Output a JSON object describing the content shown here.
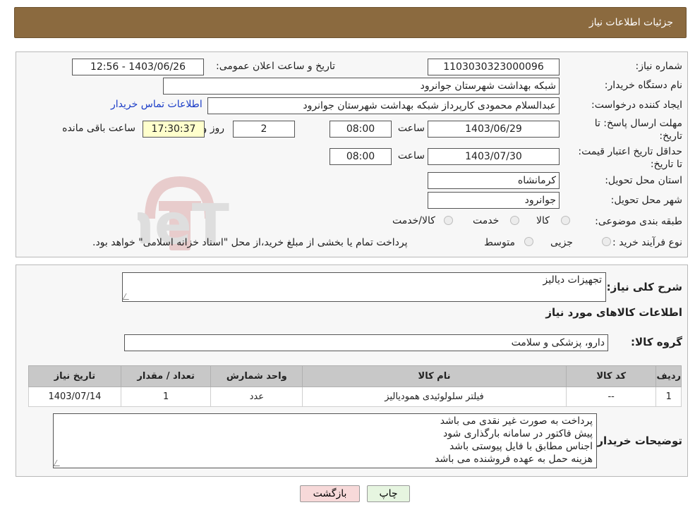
{
  "header": {
    "title": "جزئیات اطلاعات نیاز"
  },
  "form": {
    "need_number_label": "شماره نیاز:",
    "need_number": "1103030323000096",
    "announce_label": "تاریخ و ساعت اعلان عمومی:",
    "announce_value": "1403/06/26 - 12:56",
    "buyer_org_label": "نام دستگاه خریدار:",
    "buyer_org": "شبکه بهداشت شهرستان جوانرود",
    "creator_label": "ایجاد کننده درخواست:",
    "creator": "عبدالسلام محمودی کارپرداز شبکه بهداشت شهرستان جوانرود",
    "contact_link": "اطلاعات تماس خریدار",
    "deadline_label": "مهلت ارسال پاسخ: تا تاریخ:",
    "deadline_date": "1403/06/29",
    "time_label": "ساعت",
    "deadline_time": "08:00",
    "days_value": "2",
    "days_label": "روز و",
    "remaining_time": "17:30:37",
    "remaining_label": "ساعت باقی مانده",
    "validity_label": "حداقل تاریخ اعتبار قیمت: تا تاریخ:",
    "validity_date": "1403/07/30",
    "validity_time": "08:00",
    "province_label": "استان محل تحویل:",
    "province": "کرمانشاه",
    "city_label": "شهر محل تحویل:",
    "city": "جوانرود",
    "category_label": "طبقه بندی موضوعی:",
    "category_options": [
      "کالا",
      "خدمت",
      "کالا/خدمت"
    ],
    "process_label": "نوع فرآیند خرید :",
    "process_options": [
      "جزیی",
      "متوسط"
    ],
    "process_note": "پرداخت تمام یا بخشی از مبلغ خرید،از محل \"اسناد خزانه اسلامی\" خواهد بود."
  },
  "details": {
    "general_desc_label": "شرح کلی نیاز:",
    "general_desc": "تجهیزات دیالیز",
    "items_title": "اطلاعات کالاهای مورد نیاز",
    "group_label": "گروه کالا:",
    "group_value": "دارو، پزشکی و سلامت",
    "table": {
      "headers": [
        "ردیف",
        "کد کالا",
        "نام کالا",
        "واحد شمارش",
        "تعداد / مقدار",
        "تاریخ نیاز"
      ],
      "rows": [
        [
          "1",
          "--",
          "فیلتر سلولوئیدی همودیالیز",
          "عدد",
          "1",
          "1403/07/14"
        ]
      ]
    },
    "buyer_notes_label": "توضیحات خریدار:",
    "buyer_notes": [
      "پرداخت به صورت غیر نقدی می باشد",
      "پیش فاکتور در سامانه بارگذاری شود",
      "اجناس مطابق با فایل پیوستی باشد",
      "هزینه حمل به عهده فروشنده می باشد"
    ]
  },
  "buttons": {
    "print": "چاپ",
    "back": "بازگشت"
  },
  "watermark_text": "AriaTender.neT",
  "colors": {
    "header_bg": "#8b6a3f",
    "link": "#1a3cc7",
    "print_btn": "#e6f5e0",
    "back_btn": "#f7d9d9"
  }
}
